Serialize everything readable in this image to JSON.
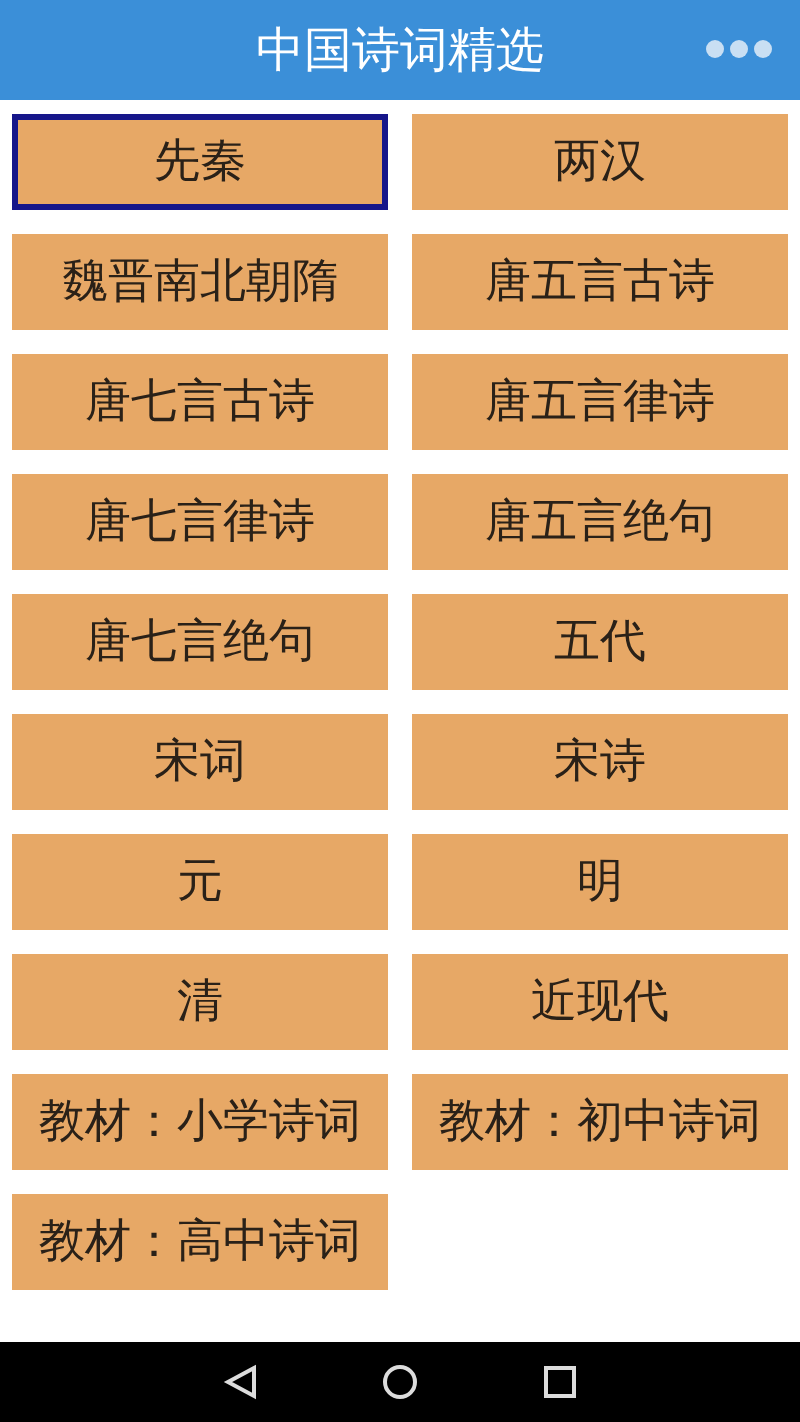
{
  "header": {
    "title": "中国诗词精选"
  },
  "categories": [
    {
      "label": "先秦",
      "selected": true
    },
    {
      "label": "两汉",
      "selected": false
    },
    {
      "label": "魏晋南北朝隋",
      "selected": false
    },
    {
      "label": "唐五言古诗",
      "selected": false
    },
    {
      "label": "唐七言古诗",
      "selected": false
    },
    {
      "label": "唐五言律诗",
      "selected": false
    },
    {
      "label": "唐七言律诗",
      "selected": false
    },
    {
      "label": "唐五言绝句",
      "selected": false
    },
    {
      "label": "唐七言绝句",
      "selected": false
    },
    {
      "label": "五代",
      "selected": false
    },
    {
      "label": "宋词",
      "selected": false
    },
    {
      "label": "宋诗",
      "selected": false
    },
    {
      "label": "元",
      "selected": false
    },
    {
      "label": "明",
      "selected": false
    },
    {
      "label": "清",
      "selected": false
    },
    {
      "label": "近现代",
      "selected": false
    },
    {
      "label": "教材：小学诗词",
      "selected": false
    },
    {
      "label": "教材：初中诗词",
      "selected": false
    },
    {
      "label": "教材：高中诗词",
      "selected": false
    }
  ]
}
